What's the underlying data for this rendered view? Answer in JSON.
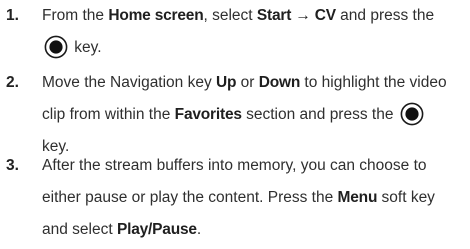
{
  "steps": [
    {
      "number": "1.",
      "line1": {
        "t1": "From the ",
        "b1": "Home screen",
        "t2": ", select ",
        "b2": "Start → CV",
        "t3": " and press the"
      },
      "line2": {
        "t1": " key."
      }
    },
    {
      "number": "2.",
      "line1": {
        "t1": "Move the Navigation key ",
        "b1": "Up",
        "t2": " or ",
        "b2": "Down",
        "t3": " to highlight the video"
      },
      "line2": {
        "t1": "clip from within the ",
        "b1": "Favorites",
        "t2": " section and press the "
      },
      "line3": {
        "t1": "key."
      }
    },
    {
      "number": "3.",
      "line1": {
        "t1": "After the stream buffers into memory, you can choose to"
      },
      "line2": {
        "t1": "either pause or play the content. Press the ",
        "b1": "Menu",
        "t2": " soft key"
      },
      "line3": {
        "t1": "and select ",
        "b1": "Play/Pause",
        "t2": "."
      }
    }
  ],
  "icons": {
    "select_key": "ok-key-icon"
  }
}
